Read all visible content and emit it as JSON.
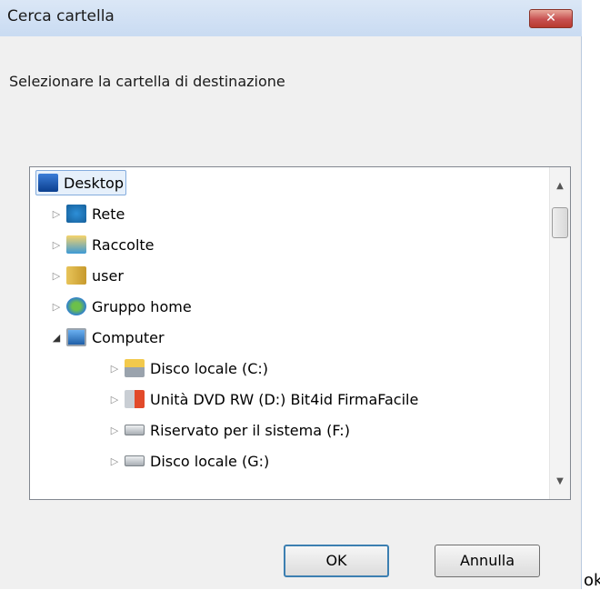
{
  "window": {
    "title": "Cerca cartella",
    "close_label": "✕"
  },
  "instruction": "Selezionare la cartella di destinazione",
  "tree": {
    "items": [
      {
        "label": "Desktop",
        "icon": "desktop-icon",
        "selected": true
      },
      {
        "label": "Rete",
        "icon": "network-icon"
      },
      {
        "label": "Raccolte",
        "icon": "libraries-icon"
      },
      {
        "label": "user",
        "icon": "user-folder-icon"
      },
      {
        "label": "Gruppo home",
        "icon": "homegroup-icon"
      },
      {
        "label": "Computer",
        "icon": "computer-icon",
        "expanded": true
      },
      {
        "label": "Disco locale (C:)",
        "icon": "local-disk-icon"
      },
      {
        "label": "Unità DVD RW (D:) Bit4id FirmaFacile",
        "icon": "dvd-drive-icon"
      },
      {
        "label": "Riservato per il sistema (F:)",
        "icon": "drive-icon"
      },
      {
        "label": "Disco locale (G:)",
        "icon": "drive-icon"
      }
    ]
  },
  "buttons": {
    "ok": "OK",
    "cancel": "Annulla"
  },
  "outside_text": "ok",
  "colors": {
    "titlebar": "#c9dbf2",
    "close": "#c75050",
    "selection": "#e6f0fb"
  }
}
